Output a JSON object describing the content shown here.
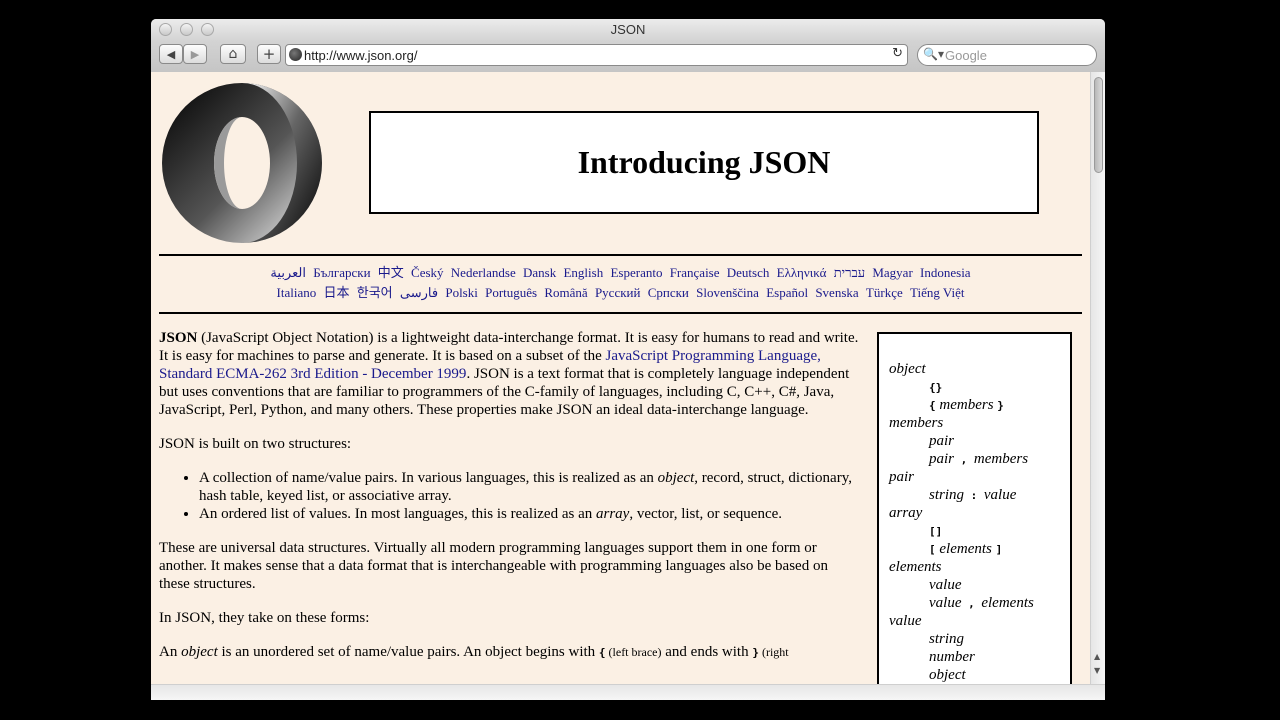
{
  "window": {
    "title": "JSON"
  },
  "toolbar": {
    "back": "◀",
    "forward": "▶",
    "home": "⌂",
    "add": "+",
    "url": "http://www.json.org/",
    "reload": "↻",
    "search_placeholder": "Google",
    "search_icon": "🔍▾"
  },
  "page": {
    "heading": "Introducing JSON",
    "languages_row1": [
      "العربية",
      "Български",
      "中文",
      "Český",
      "Nederlandse",
      "Dansk",
      "English",
      "Esperanto",
      "Française",
      "Deutsch",
      "Ελληνικά",
      "עברית",
      "Magyar",
      "Indonesia"
    ],
    "languages_row2": [
      "Italiano",
      "日本",
      "한국어",
      "فارسی",
      "Polski",
      "Português",
      "Română",
      "Русский",
      "Српски",
      "Slovenščina",
      "Español",
      "Svenska",
      "Türkçe",
      "Tiếng Việt"
    ],
    "intro_bold": "JSON",
    "intro_1": " (JavaScript Object Notation) is a lightweight data-interchange format. It is easy for humans to read and write. It is easy for machines to parse and generate. It is based on a subset of the ",
    "intro_link": "JavaScript Programming Language, Standard ECMA-262 3rd Edition - December 1999",
    "intro_2": ". JSON is a text format that is completely language independent but uses conventions that are familiar to programmers of the C-family of languages, including C, C++, C#, Java, JavaScript, Perl, Python, and many others. These properties make JSON an ideal data-interchange language.",
    "built_on": "JSON is built on two structures:",
    "bullet1_a": "A collection of name/value pairs. In various languages, this is realized as an ",
    "bullet1_em": "object",
    "bullet1_b": ", record, struct, dictionary, hash table, keyed list, or associative array.",
    "bullet2_a": "An ordered list of values. In most languages, this is realized as an ",
    "bullet2_em": "array",
    "bullet2_b": ", vector, list, or sequence.",
    "universal": "These are universal data structures. Virtually all modern programming languages support them in one form or another. It makes sense that a data format that is interchangeable with programming languages also be based on these structures.",
    "forms": "In JSON, they take on these forms:",
    "object_a": "An ",
    "object_em": "object",
    "object_b": " is an unordered set of name/value pairs. An object begins with ",
    "object_lbrace": "{",
    "object_c": " (left brace)",
    "object_d": " and ends with ",
    "object_rbrace": "}",
    "object_e": " (right"
  },
  "grammar": {
    "object": "object",
    "obj_r1": "{}",
    "obj_r2_open": "{",
    "obj_r2_nt": " members ",
    "obj_r2_close": "}",
    "members": "members",
    "mem_r1": "pair",
    "mem_r2_nt": "pair",
    "mem_r2_tok": " , ",
    "mem_r2_nt2": "members",
    "pair": "pair",
    "pair_r1_nt": "string",
    "pair_r1_tok": " : ",
    "pair_r1_nt2": "value",
    "array": "array",
    "arr_r1": "[]",
    "arr_r2_open": "[",
    "arr_r2_nt": " elements ",
    "arr_r2_close": "]",
    "elements": "elements",
    "el_r1": "value",
    "el_r2_nt": "value",
    "el_r2_tok": " , ",
    "el_r2_nt2": "elements",
    "value": "value",
    "val_r1": "string",
    "val_r2": "number",
    "val_r3": "object"
  }
}
